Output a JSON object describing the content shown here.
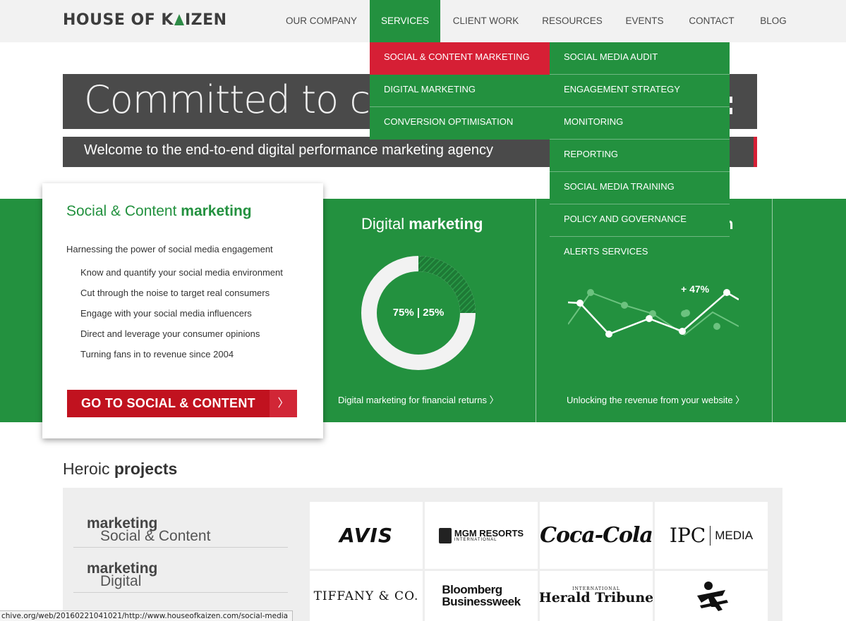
{
  "header": {
    "logo_left": "HOUSE OF K",
    "logo_right": "IZEN",
    "nav": [
      {
        "label": "OUR COMPANY"
      },
      {
        "label": "SERVICES"
      },
      {
        "label": "CLIENT WORK"
      },
      {
        "label": "RESOURCES"
      },
      {
        "label": "EVENTS"
      },
      {
        "label": "CONTACT"
      },
      {
        "label": "BLOG"
      }
    ]
  },
  "dropdown": {
    "primary": [
      {
        "label": "SOCIAL & CONTENT MARKETING"
      },
      {
        "label": "DIGITAL MARKETING"
      },
      {
        "label": "CONVERSION OPTIMISATION"
      }
    ],
    "secondary": [
      {
        "label": "SOCIAL MEDIA AUDIT"
      },
      {
        "label": "ENGAGEMENT STRATEGY"
      },
      {
        "label": "MONITORING"
      },
      {
        "label": "REPORTING"
      },
      {
        "label": "SOCIAL MEDIA TRAINING"
      },
      {
        "label": "POLICY AND GOVERNANCE"
      },
      {
        "label": "ALERTS SERVICES"
      }
    ]
  },
  "hero": {
    "title": "Committed to con",
    "subtitle": "Welcome to the end-to-end digital performance marketing agency"
  },
  "card": {
    "title_light": "Social & Content ",
    "title_bold": "marketing",
    "intro": "Harnessing the power of social media engagement",
    "bullets": [
      "Know and quantify your social media environment",
      "Cut through the noise to target real consumers",
      "Engage with your social media influencers",
      "Direct and leverage your consumer opinions",
      "Turning fans in to revenue since 2004"
    ],
    "cta": "GO TO SOCIAL & CONTENT",
    "cta_arrow": "〉"
  },
  "digital": {
    "title_light": "Digital ",
    "title_bold": "marketing",
    "donut_label": "75% |  25%",
    "donut_split": 0.75,
    "link": "Digital marketing for financial returns 〉"
  },
  "conversion": {
    "title_partial": "n",
    "growth_label": "+ 47%",
    "link": "Unlocking the revenue from your website 〉"
  },
  "projects": {
    "title_light": "Heroic ",
    "title_bold": "projects",
    "categories": [
      {
        "light": "Social & Content ",
        "bold": "marketing"
      },
      {
        "light": "Digital ",
        "bold": "marketing"
      }
    ],
    "logos": [
      "AVIS",
      "MGM RESORTS",
      "INTERNATIONAL",
      "Coca-Cola",
      "IPC",
      "MEDIA",
      "TIFFANY & CO.",
      "Bloomberg",
      "Businessweek",
      "INTERNATIONAL",
      "Herald Tribune",
      "msf-logo"
    ]
  },
  "colors": {
    "green": "#23913f",
    "red": "#d61f35",
    "dark_grey": "#4a4a4a"
  },
  "statusbar": "chive.org/web/20160221041021/http://www.houseofkaizen.com/social-media"
}
